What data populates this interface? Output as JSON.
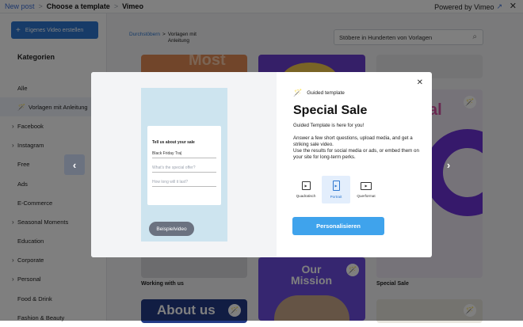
{
  "topbar": {
    "breadcrumb": [
      "New post",
      "Choose a template",
      "Vimeo"
    ],
    "powered_by": "Powered by Vimeo",
    "external_icon": "external-link-icon",
    "close_icon": "close-icon"
  },
  "sidebar": {
    "create_button": "Eigenes Video erstellen",
    "categories_heading": "Kategorien",
    "items": [
      {
        "label": "Alle",
        "chevron": false,
        "active": false
      },
      {
        "label": "Vorlagen mit Anleitung",
        "chevron": false,
        "active": true,
        "icon": "wand-icon"
      },
      {
        "label": "Facebook",
        "chevron": true,
        "active": false
      },
      {
        "label": "Instagram",
        "chevron": true,
        "active": false
      },
      {
        "label": "Free",
        "chevron": false,
        "active": false
      },
      {
        "label": "Ads",
        "chevron": false,
        "active": false
      },
      {
        "label": "E-Commerce",
        "chevron": false,
        "active": false
      },
      {
        "label": "Seasonal Moments",
        "chevron": true,
        "active": false
      },
      {
        "label": "Education",
        "chevron": false,
        "active": false
      },
      {
        "label": "Corporate",
        "chevron": true,
        "active": false
      },
      {
        "label": "Personal",
        "chevron": true,
        "active": false
      },
      {
        "label": "Food & Drink",
        "chevron": false,
        "active": false
      },
      {
        "label": "Fashion & Beauty",
        "chevron": false,
        "active": false
      }
    ]
  },
  "main": {
    "breadcrumb_link": "Durchstöbern",
    "breadcrumb_sep": ">",
    "breadcrumb_current": "Vorlagen mit Anleitung",
    "search_placeholder": "Stöbere in Hunderten von Vorlagen",
    "card_captions": [
      "Working with us",
      "Special Sale"
    ],
    "card_texts": {
      "most": "Most",
      "our_mission": "Our Mission",
      "about": "About us"
    }
  },
  "modal": {
    "guided_label": "Guided template",
    "title": "Special Sale",
    "subtitle": "Guided Template is here for you!",
    "description_1": "Answer a few short questions, upload media, and get a striking sale video.",
    "description_2": "Use the results for social media or ads, or embed them on your site for long-term perks.",
    "formats": [
      {
        "label": "Quadratisch",
        "selected": false
      },
      {
        "label": "Portrait",
        "selected": true
      },
      {
        "label": "Querformat",
        "selected": false
      }
    ],
    "personalize_button": "Personalisieren",
    "preview": {
      "form_title": "Tell us about your sale",
      "field_1": "Black Friday Tra|",
      "field_2_placeholder": "What's the special offer?",
      "field_3_placeholder": "How long will it last?",
      "sample_button": "Beispielvideo"
    }
  },
  "colors": {
    "accent": "#2e77d0",
    "primary_button": "#3fa3ec",
    "preview_bg": "#cde4ef"
  }
}
